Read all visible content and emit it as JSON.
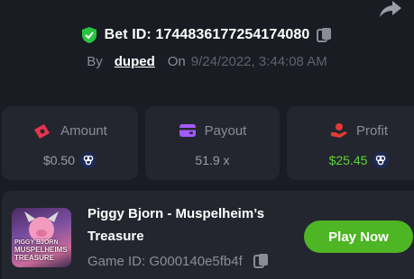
{
  "bet": {
    "id_label": "Bet ID: 1744836177254174080"
  },
  "meta": {
    "by_label": "By",
    "user": "duped",
    "on_label": "On",
    "date": "9/24/2022, 3:44:08 AM"
  },
  "stats": [
    {
      "label": "Amount",
      "value": "$0.50",
      "icon": "money-bill-icon",
      "color": "#e8334f"
    },
    {
      "label": "Payout",
      "value": "51.9 x",
      "icon": "wallet-icon",
      "color": "#a35bff"
    },
    {
      "label": "Profit",
      "value": "$25.45",
      "icon": "hand-coin-icon",
      "color": "#e53935"
    }
  ],
  "game": {
    "title": "Piggy Bjorn - Muspelheim’s Treasure",
    "id_label": "Game ID: G000140e5fb4f",
    "thumb_lines": [
      "PIGGY BJORN",
      "MUSPELHEIMS",
      "TREASURE"
    ],
    "play_label": "Play Now"
  },
  "colors": {
    "accent": "#4eb524",
    "profit": "#5cd43a",
    "shield": "#29c43f"
  }
}
